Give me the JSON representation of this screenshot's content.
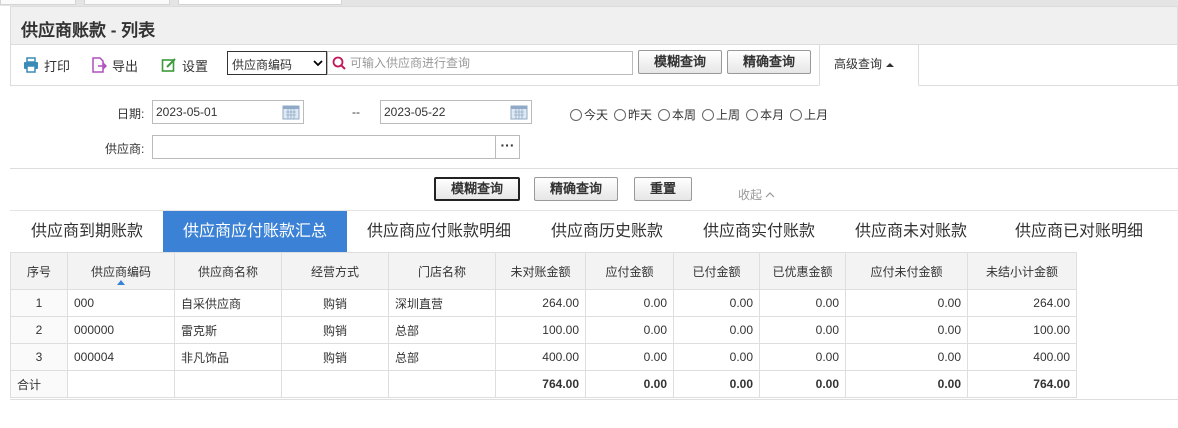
{
  "page": {
    "title": "供应商账款 - 列表"
  },
  "toolbar": {
    "print_label": "打印",
    "export_label": "导出",
    "settings_label": "设置",
    "search_field": "供应商编码",
    "search_placeholder": "可输入供应商进行查询",
    "fuzzy_label": "模糊查询",
    "exact_label": "精确查询",
    "advanced_label": "高级查询"
  },
  "filters": {
    "date_label": "日期:",
    "date_from": "2023-05-01",
    "date_sep": "--",
    "date_to": "2023-05-22",
    "ranges": [
      "今天",
      "昨天",
      "本周",
      "上周",
      "本月",
      "上月"
    ],
    "supplier_label": "供应商:",
    "supplier_value": "",
    "fuzzy_label": "模糊查询",
    "exact_label": "精确查询",
    "reset_label": "重置",
    "collapse_label": "收起"
  },
  "tabs": [
    "供应商到期账款",
    "供应商应付账款汇总",
    "供应商应付账款明细",
    "供应商历史账款",
    "供应商实付账款",
    "供应商未对账款",
    "供应商已对账明细"
  ],
  "active_tab": "供应商应付账款汇总",
  "table": {
    "columns": [
      "序号",
      "供应商编码",
      "供应商名称",
      "经营方式",
      "门店名称",
      "未对账金额",
      "应付金额",
      "已付金额",
      "已优惠金额",
      "应付未付金额",
      "未结小计金额"
    ],
    "rows": [
      [
        "1",
        "000",
        "自采供应商",
        "购销",
        "深圳直营",
        "264.00",
        "0.00",
        "0.00",
        "0.00",
        "0.00",
        "264.00"
      ],
      [
        "2",
        "000000",
        "雷克斯",
        "购销",
        "总部",
        "100.00",
        "0.00",
        "0.00",
        "0.00",
        "0.00",
        "100.00"
      ],
      [
        "3",
        "000004",
        "非凡饰品",
        "购销",
        "总部",
        "400.00",
        "0.00",
        "0.00",
        "0.00",
        "0.00",
        "400.00"
      ]
    ],
    "total": [
      "合计",
      "",
      "",
      "",
      "",
      "764.00",
      "0.00",
      "0.00",
      "0.00",
      "0.00",
      "764.00"
    ]
  },
  "colors": {
    "accent": "#3b82d6"
  },
  "icons": [
    "printer-icon",
    "export-icon",
    "settings-icon",
    "search-icon",
    "calendar-icon",
    "sort-asc-icon"
  ]
}
